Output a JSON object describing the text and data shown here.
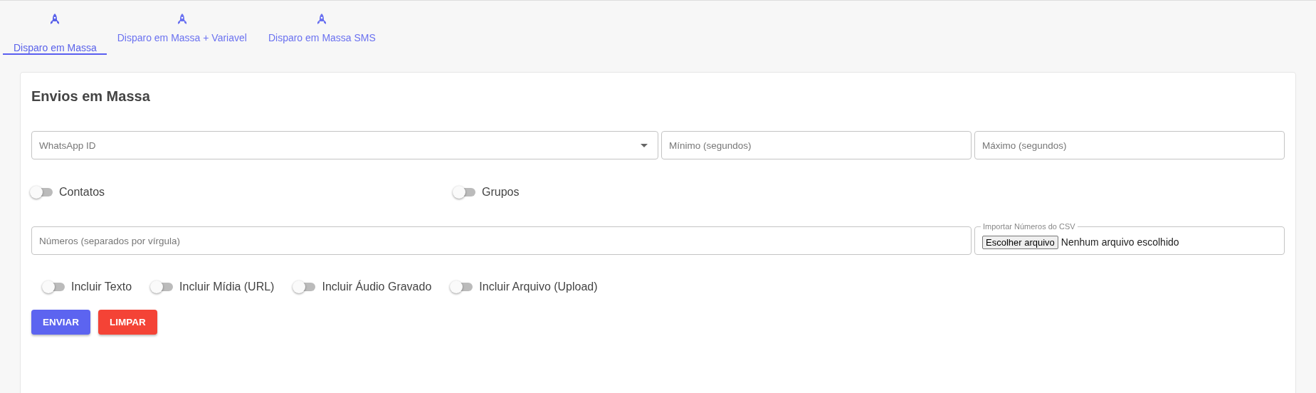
{
  "tabs": [
    {
      "label": "Disparo em Massa",
      "selected": true
    },
    {
      "label": "Disparo em Massa + Variavel",
      "selected": false
    },
    {
      "label": "Disparo em Massa SMS",
      "selected": false
    }
  ],
  "card": {
    "title": "Envios em Massa",
    "row1": [
      {
        "kind": "select",
        "placeholder": "WhatsApp ID"
      },
      {
        "kind": "text",
        "placeholder": "Mínimo (segundos)"
      },
      {
        "kind": "text",
        "placeholder": "Máximo (segundos)"
      }
    ],
    "targets": [
      {
        "label": "Contatos",
        "on": false
      },
      {
        "label": "Grupos",
        "on": false
      }
    ],
    "numbers": {
      "placeholder": "Números (separados por vírgula)"
    },
    "csv": {
      "label": "Importar Números do CSV",
      "button": "Escolher arquivo",
      "status": "Nenhum arquivo escolhido"
    },
    "options": [
      {
        "label": "Incluir Texto",
        "on": false
      },
      {
        "label": "Incluir Mídia (URL)",
        "on": false
      },
      {
        "label": "Incluir Áudio Gravado",
        "on": false
      },
      {
        "label": "Incluir Arquivo (Upload)",
        "on": false
      }
    ],
    "buttons": [
      {
        "label": "ENVIAR",
        "kind": "primary"
      },
      {
        "label": "LIMPAR",
        "kind": "danger"
      }
    ]
  }
}
